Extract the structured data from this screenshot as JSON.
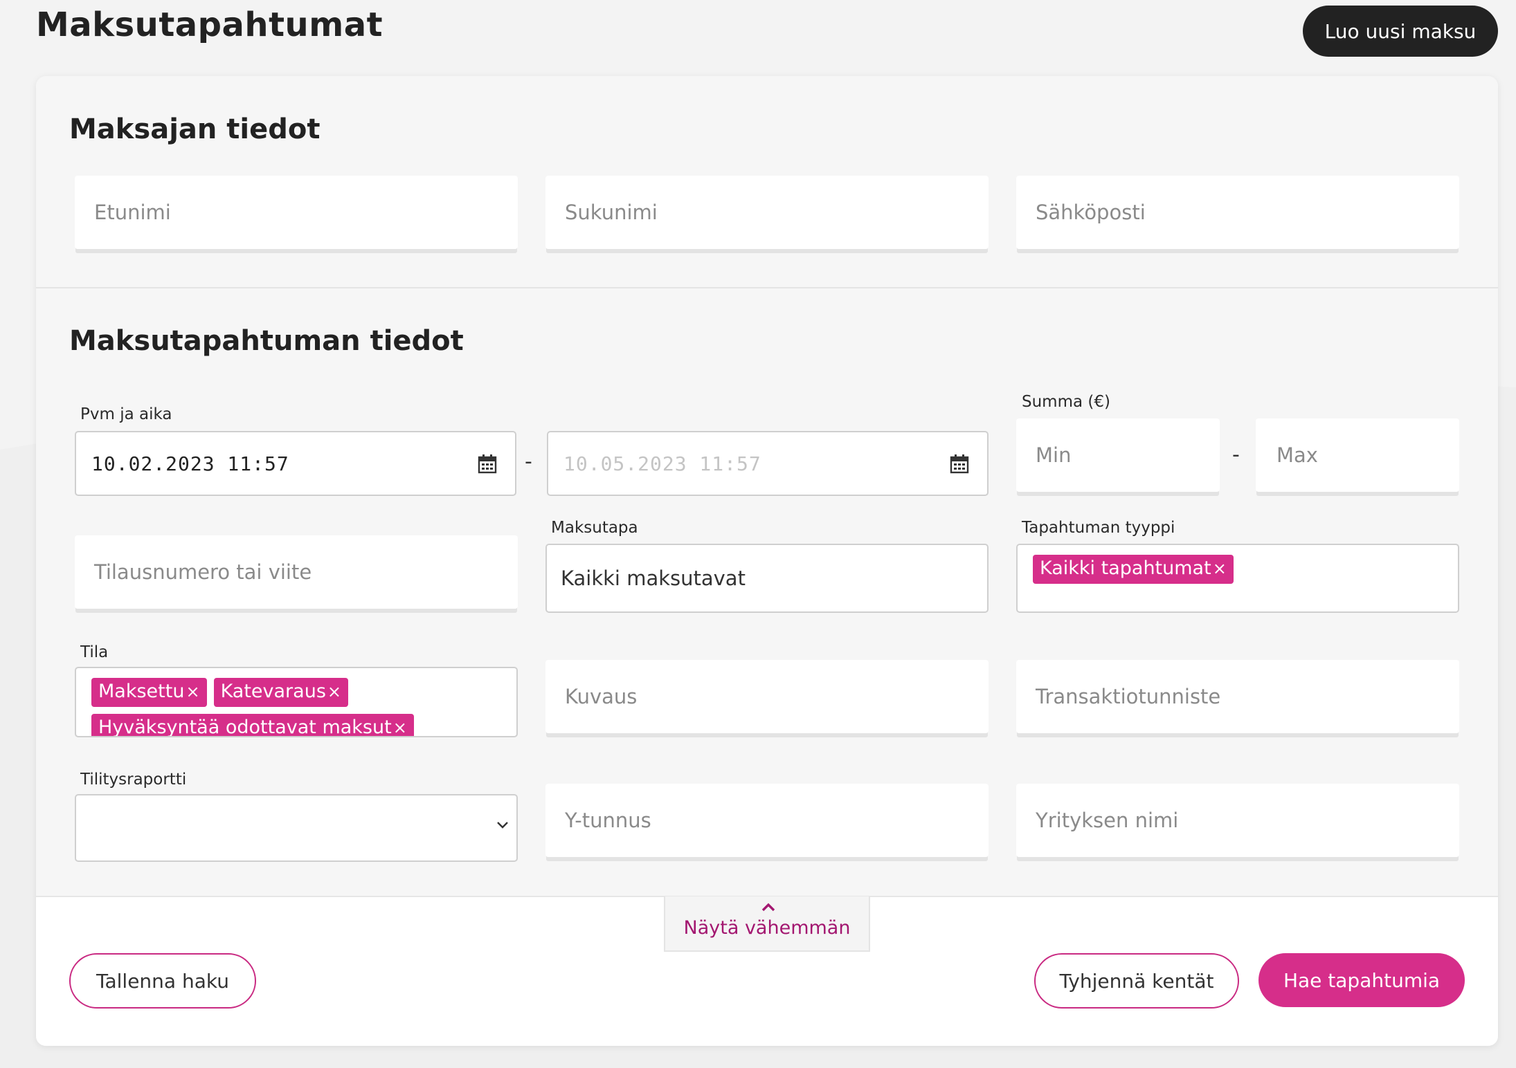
{
  "header": {
    "title": "Maksutapahtumat",
    "new_payment_button": "Luo uusi maksu"
  },
  "payer": {
    "title": "Maksajan tiedot",
    "first_name_placeholder": "Etunimi",
    "last_name_placeholder": "Sukunimi",
    "email_placeholder": "Sähköposti"
  },
  "transaction": {
    "title": "Maksutapahtuman tiedot",
    "date_label": "Pvm ja aika",
    "date_from": "10.02.2023 11:57",
    "date_to_placeholder": "10.05.2023 11:57",
    "date_separator": "-",
    "amount_label": "Summa (€)",
    "amount_min_placeholder": "Min",
    "amount_max_placeholder": "Max",
    "amount_separator": "-",
    "order_ref_placeholder": "Tilausnumero tai viite",
    "payment_method_label": "Maksutapa",
    "payment_method_value": "Kaikki maksutavat",
    "event_type_label": "Tapahtuman tyyppi",
    "event_type_chips": [
      "Kaikki tapahtumat"
    ],
    "status_label": "Tila",
    "status_chips": [
      "Maksettu",
      "Katevaraus",
      "Hyväksyntää odottavat maksut"
    ],
    "description_placeholder": "Kuvaus",
    "transaction_id_placeholder": "Transaktiotunniste",
    "settlement_report_label": "Tilitysraportti",
    "settlement_report_value": "",
    "business_id_placeholder": "Y-tunnus",
    "company_name_placeholder": "Yrityksen nimi",
    "chip_remove_symbol": "×"
  },
  "footer": {
    "show_less": "Näytä vähemmän",
    "save_search": "Tallenna haku",
    "clear_fields": "Tyhjennä kentät",
    "search": "Hae tapahtumia"
  },
  "colors": {
    "accent": "#d62e8a",
    "accent_dark": "#a31770",
    "dark_button": "#222222"
  },
  "icons": [
    "calendar-icon",
    "chevron-down-icon",
    "chevron-up-icon",
    "remove-chip-icon"
  ]
}
